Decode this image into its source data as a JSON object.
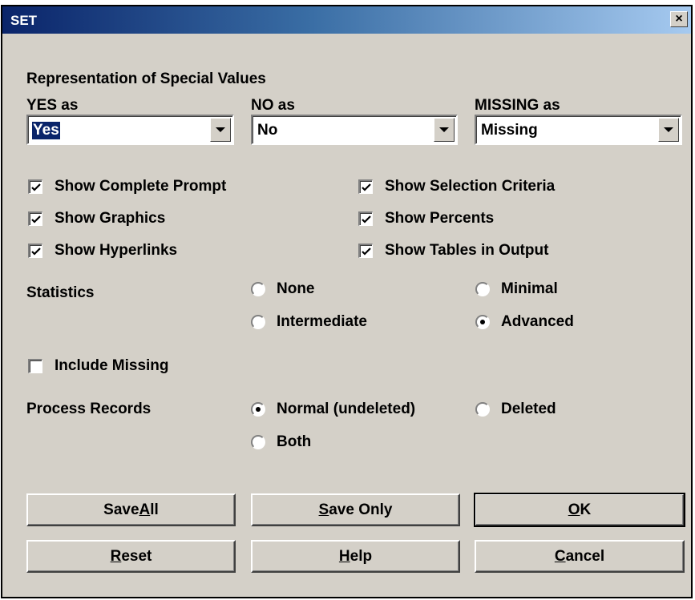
{
  "window": {
    "title": "SET",
    "close_glyph": "×"
  },
  "section_title": "Representation of Special Values",
  "combos": {
    "yes": {
      "label": "YES as",
      "value": "Yes"
    },
    "no": {
      "label": "NO as",
      "value": "No"
    },
    "missing": {
      "label": "MISSING as",
      "value": "Missing"
    }
  },
  "checkboxes": [
    {
      "label": "Show Complete Prompt",
      "checked": true
    },
    {
      "label": "Show Graphics",
      "checked": true
    },
    {
      "label": "Show Hyperlinks",
      "checked": true
    },
    {
      "label": "Show Selection Criteria",
      "checked": true
    },
    {
      "label": "Show Percents",
      "checked": true
    },
    {
      "label": "Show Tables in Output",
      "checked": true
    }
  ],
  "statistics": {
    "label": "Statistics",
    "options": [
      {
        "label": "None",
        "selected": false
      },
      {
        "label": "Minimal",
        "selected": false
      },
      {
        "label": "Intermediate",
        "selected": false
      },
      {
        "label": "Advanced",
        "selected": true
      }
    ]
  },
  "include_missing": {
    "label": "Include Missing",
    "checked": false
  },
  "process_records": {
    "label": "Process Records",
    "options": [
      {
        "label": "Normal (undeleted)",
        "selected": true
      },
      {
        "label": "Deleted",
        "selected": false
      },
      {
        "label": "Both",
        "selected": false
      }
    ]
  },
  "buttons": {
    "save_all": {
      "pre": "Save ",
      "key": "A",
      "post": "ll"
    },
    "save_only": {
      "pre": "",
      "key": "S",
      "post": "ave Only"
    },
    "ok": {
      "pre": "",
      "key": "O",
      "post": "K"
    },
    "reset": {
      "pre": "",
      "key": "R",
      "post": "eset"
    },
    "help": {
      "pre": "",
      "key": "H",
      "post": "elp"
    },
    "cancel": {
      "pre": "",
      "key": "C",
      "post": "ancel"
    }
  }
}
